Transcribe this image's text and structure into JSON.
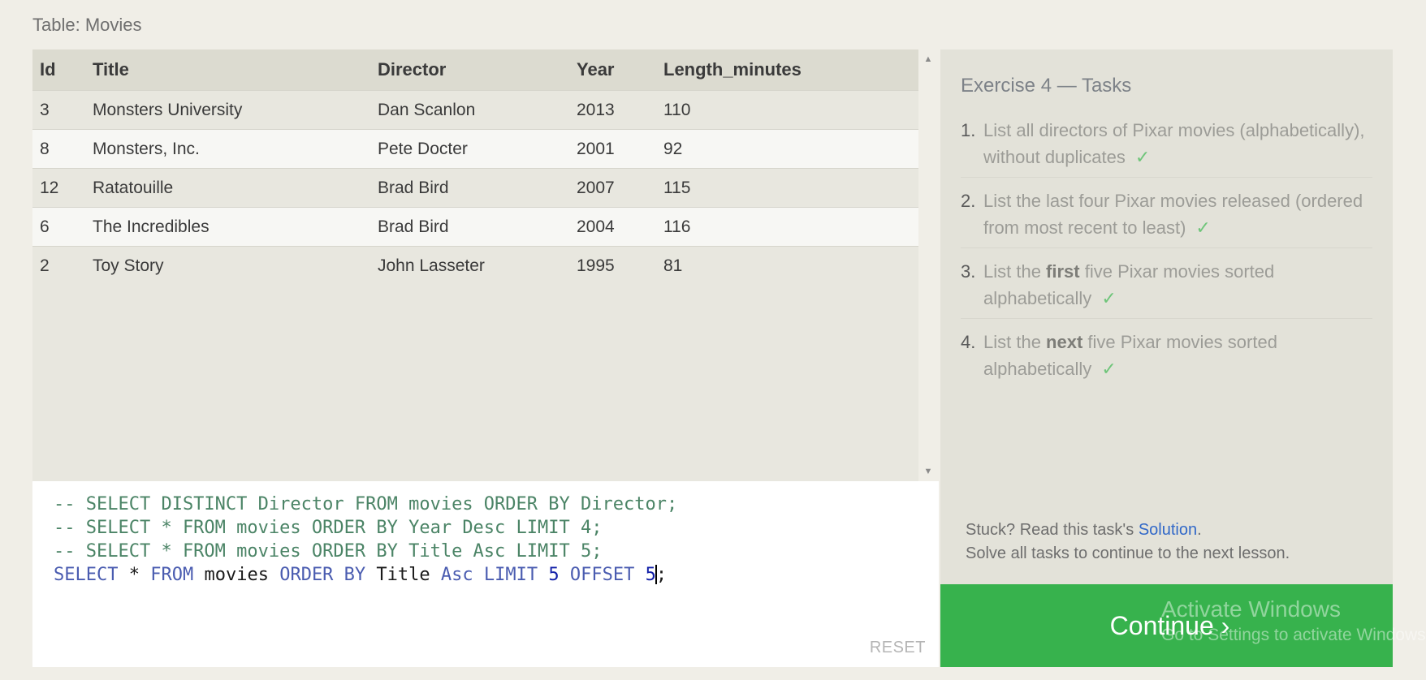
{
  "table_caption": "Table: Movies",
  "columns": [
    "Id",
    "Title",
    "Director",
    "Year",
    "Length_minutes"
  ],
  "rows": [
    {
      "id": "3",
      "title": "Monsters University",
      "director": "Dan Scanlon",
      "year": "2013",
      "length": "110"
    },
    {
      "id": "8",
      "title": "Monsters, Inc.",
      "director": "Pete Docter",
      "year": "2001",
      "length": "92"
    },
    {
      "id": "12",
      "title": "Ratatouille",
      "director": "Brad Bird",
      "year": "2007",
      "length": "115"
    },
    {
      "id": "6",
      "title": "The Incredibles",
      "director": "Brad Bird",
      "year": "2004",
      "length": "116"
    },
    {
      "id": "2",
      "title": "Toy Story",
      "director": "John Lasseter",
      "year": "1995",
      "length": "81"
    }
  ],
  "editor": {
    "lines": [
      "-- SELECT DISTINCT Director FROM movies ORDER BY Director;",
      "-- SELECT * FROM movies ORDER BY Year Desc LIMIT 4;",
      "-- SELECT * FROM movies ORDER BY Title Asc LIMIT 5;"
    ],
    "query": {
      "select": "SELECT",
      "star": "*",
      "from": "FROM",
      "table": "movies",
      "order_by": "ORDER BY",
      "column": "Title",
      "direction": "Asc",
      "limit": "LIMIT",
      "limit_value": "5",
      "offset": "OFFSET",
      "offset_value": "5",
      "terminator": ";"
    },
    "reset_label": "RESET"
  },
  "tasks": {
    "title": "Exercise 4 — Tasks",
    "items": [
      {
        "number": "1.",
        "text": "List all directors of Pixar movies (alphabetically), without duplicates",
        "check": "✓"
      },
      {
        "number": "2.",
        "text": "List the last four Pixar movies released (ordered from most recent to least)",
        "check": "✓"
      },
      {
        "number": "3.",
        "before": "List the ",
        "bold": "first",
        "after": " five Pixar movies sorted alphabetically",
        "check": "✓"
      },
      {
        "number": "4.",
        "before": "List the ",
        "bold": "next",
        "after": " five Pixar movies sorted alphabetically",
        "check": "✓"
      }
    ]
  },
  "help": {
    "stuck_prefix": "Stuck? Read this task's ",
    "solution_link": "Solution",
    "stuck_suffix": ".",
    "line2": "Solve all tasks to continue to the next lesson."
  },
  "continue": {
    "label": "Continue",
    "chevron": "›"
  },
  "watermark": {
    "title": "Activate Windows",
    "subtitle": "Go to Settings to activate Windows."
  },
  "colors": {
    "continue_bg": "#37b24d",
    "check": "#6fc57a",
    "link": "#3168c8",
    "keyword": "#4a5cb0",
    "comment": "#4b8466"
  }
}
